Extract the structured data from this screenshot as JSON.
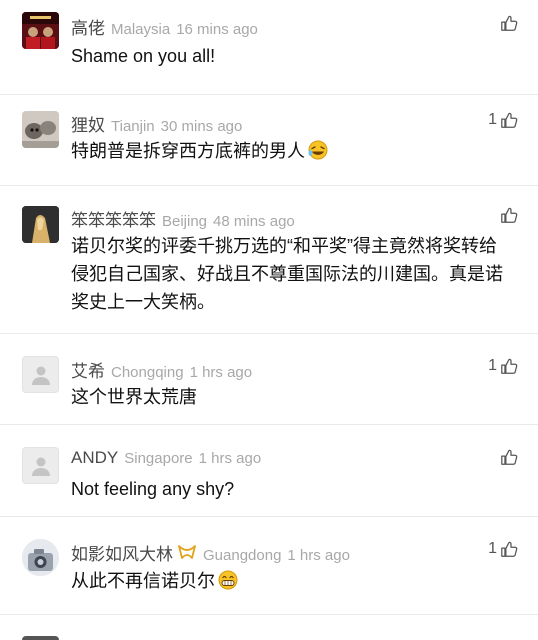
{
  "comments": [
    {
      "name": "高佬",
      "location": "Malaysia",
      "time": "16 mins ago",
      "text": "Shame on you all!",
      "likes": ""
    },
    {
      "name": "狸奴",
      "location": "Tianjin",
      "time": "30 mins ago",
      "text": "特朗普是拆穿西方底裤的男人",
      "likes": "1"
    },
    {
      "name": "笨笨笨笨笨",
      "location": "Beijing",
      "time": "48 mins ago",
      "text": "诺贝尔奖的评委千挑万选的“和平奖”得主竟然将奖转给侵犯自己国家、好战且不尊重国际法的川建国。真是诺奖史上一大笑柄。",
      "likes": ""
    },
    {
      "name": "艾希",
      "location": "Chongqing",
      "time": "1 hrs ago",
      "text": "这个世界太荒唐",
      "likes": "1"
    },
    {
      "name": "ANDY",
      "location": "Singapore",
      "time": "1 hrs ago",
      "text": "Not feeling any shy?",
      "likes": ""
    },
    {
      "name": "如影如风大林",
      "location": "Guangdong",
      "time": "1 hrs ago",
      "text": "从此不再信诺贝尔",
      "likes": "1"
    }
  ],
  "icons": {
    "like": "thumbs-up-icon",
    "default_avatar": "person-icon",
    "emoji_laugh": "laughing-emoji-icon",
    "emoji_grin": "grinning-emoji-icon",
    "badge": "ribbon-badge-icon"
  },
  "colors": {
    "name": "#4a4a4a",
    "meta": "#a8a8a8",
    "text": "#111111",
    "divider": "#e9e9e9"
  }
}
